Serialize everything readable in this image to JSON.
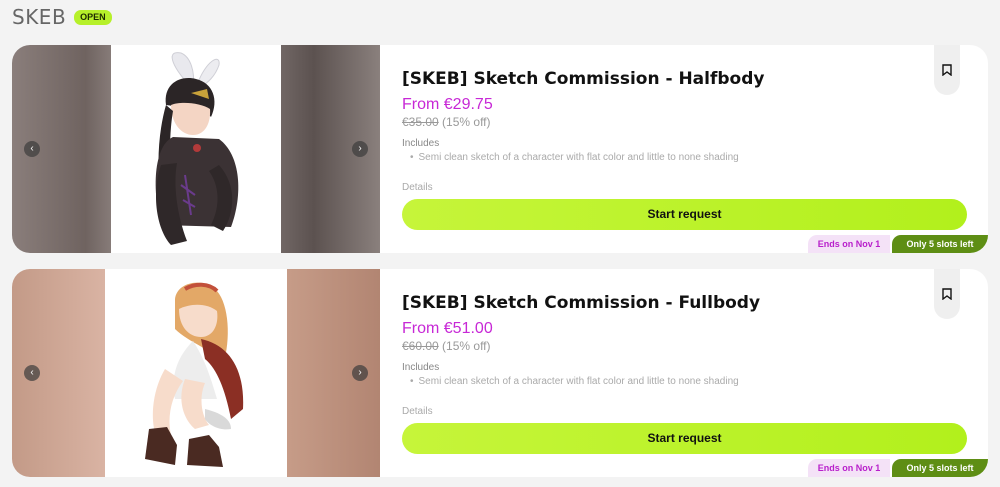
{
  "header": {
    "title": "SKEB",
    "status_badge": "OPEN"
  },
  "listings": [
    {
      "title": "[SKEB] Sketch Commission - Halfbody",
      "price": "From €29.75",
      "original_price": "€35.00",
      "discount": "(15% off)",
      "includes_label": "Includes",
      "includes_items": [
        "Semi clean sketch of a character with flat color and little to none shading"
      ],
      "details_label": "Details",
      "cta_label": "Start request",
      "ends_badge": "Ends on Nov 1",
      "slots_badge": "Only 5 slots left"
    },
    {
      "title": "[SKEB] Sketch Commission - Fullbody",
      "price": "From €51.00",
      "original_price": "€60.00",
      "discount": "(15% off)",
      "includes_label": "Includes",
      "includes_items": [
        "Semi clean sketch of a character with flat color and little to none shading"
      ],
      "details_label": "Details",
      "cta_label": "Start request",
      "ends_badge": "Ends on Nov 1",
      "slots_badge": "Only 5 slots left"
    }
  ],
  "icons": {
    "prev": "chevron-left-icon",
    "next": "chevron-right-icon",
    "bookmark": "bookmark-icon",
    "prev_glyph": "‹",
    "next_glyph": "›"
  },
  "colors": {
    "accent_lime": "#b6f02a",
    "price_magenta": "#c728d6",
    "slots_green": "#5e8e14",
    "ends_pink_bg": "#f4e2f7"
  }
}
